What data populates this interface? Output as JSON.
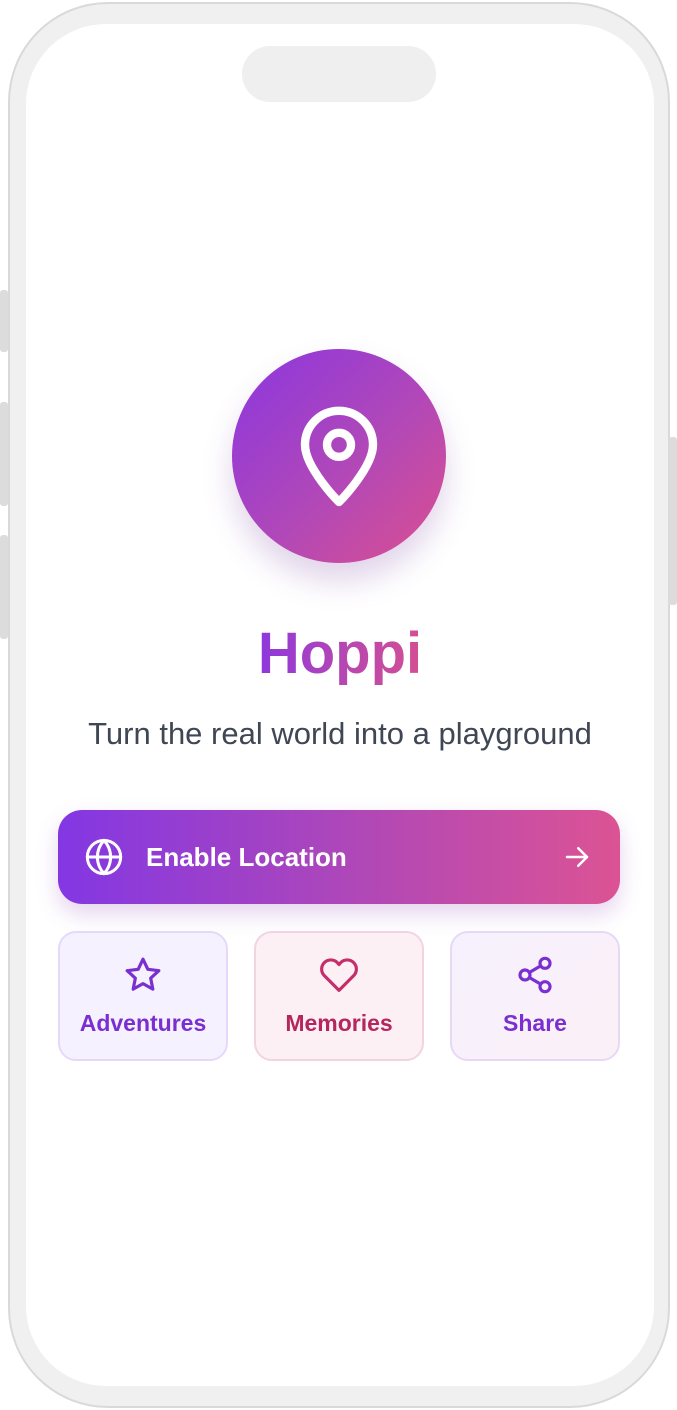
{
  "app": {
    "title": "Hoppi",
    "tagline": "Turn the real world into a playground"
  },
  "primary_action": {
    "label": "Enable Location",
    "icon": "globe-icon",
    "trailing_icon": "arrow-right-icon"
  },
  "tiles": [
    {
      "label": "Adventures",
      "icon": "star-icon",
      "color": "#7a2fd0"
    },
    {
      "label": "Memories",
      "icon": "heart-icon",
      "color": "#b5275c"
    },
    {
      "label": "Share",
      "icon": "share-icon",
      "color": "#7a2fd0"
    }
  ],
  "logo": {
    "icon": "map-pin-icon"
  },
  "colors": {
    "accent_purple": "#8b36e0",
    "accent_pink": "#db4f8f",
    "tagline": "#3f4654"
  }
}
